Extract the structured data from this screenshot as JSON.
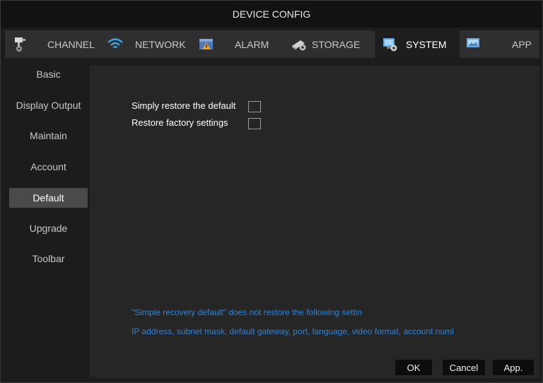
{
  "window": {
    "title": "DEVICE CONFIG"
  },
  "tabs": [
    {
      "label": "CHANNEL",
      "icon": "camera-icon"
    },
    {
      "label": "NETWORK",
      "icon": "wifi-icon"
    },
    {
      "label": "ALARM",
      "icon": "alarm-icon"
    },
    {
      "label": "STORAGE",
      "icon": "storage-icon"
    },
    {
      "label": "SYSTEM",
      "icon": "system-icon",
      "active": true
    },
    {
      "label": "APP",
      "icon": "app-icon"
    }
  ],
  "sidebar": {
    "items": [
      {
        "label": "Basic"
      },
      {
        "label": "Display Output"
      },
      {
        "label": "Maintain"
      },
      {
        "label": "Account"
      },
      {
        "label": "Default",
        "active": true
      },
      {
        "label": "Upgrade"
      },
      {
        "label": "Toolbar"
      }
    ]
  },
  "options": {
    "simple_restore": {
      "label": "Simply restore the default",
      "checked": false
    },
    "factory_restore": {
      "label": "Restore factory settings",
      "checked": false
    }
  },
  "notes": {
    "line1": "\"Simple recovery default\" does not restore the following settin",
    "line2": "IP address, subnet mask, default gateway, port, language, video format, account numl"
  },
  "buttons": {
    "ok": "OK",
    "cancel": "Cancel",
    "apply": "App."
  },
  "colors": {
    "note": "#2f83d8",
    "active_tab": "#1e1e1e",
    "tab_bar": "#2f2f2f"
  }
}
